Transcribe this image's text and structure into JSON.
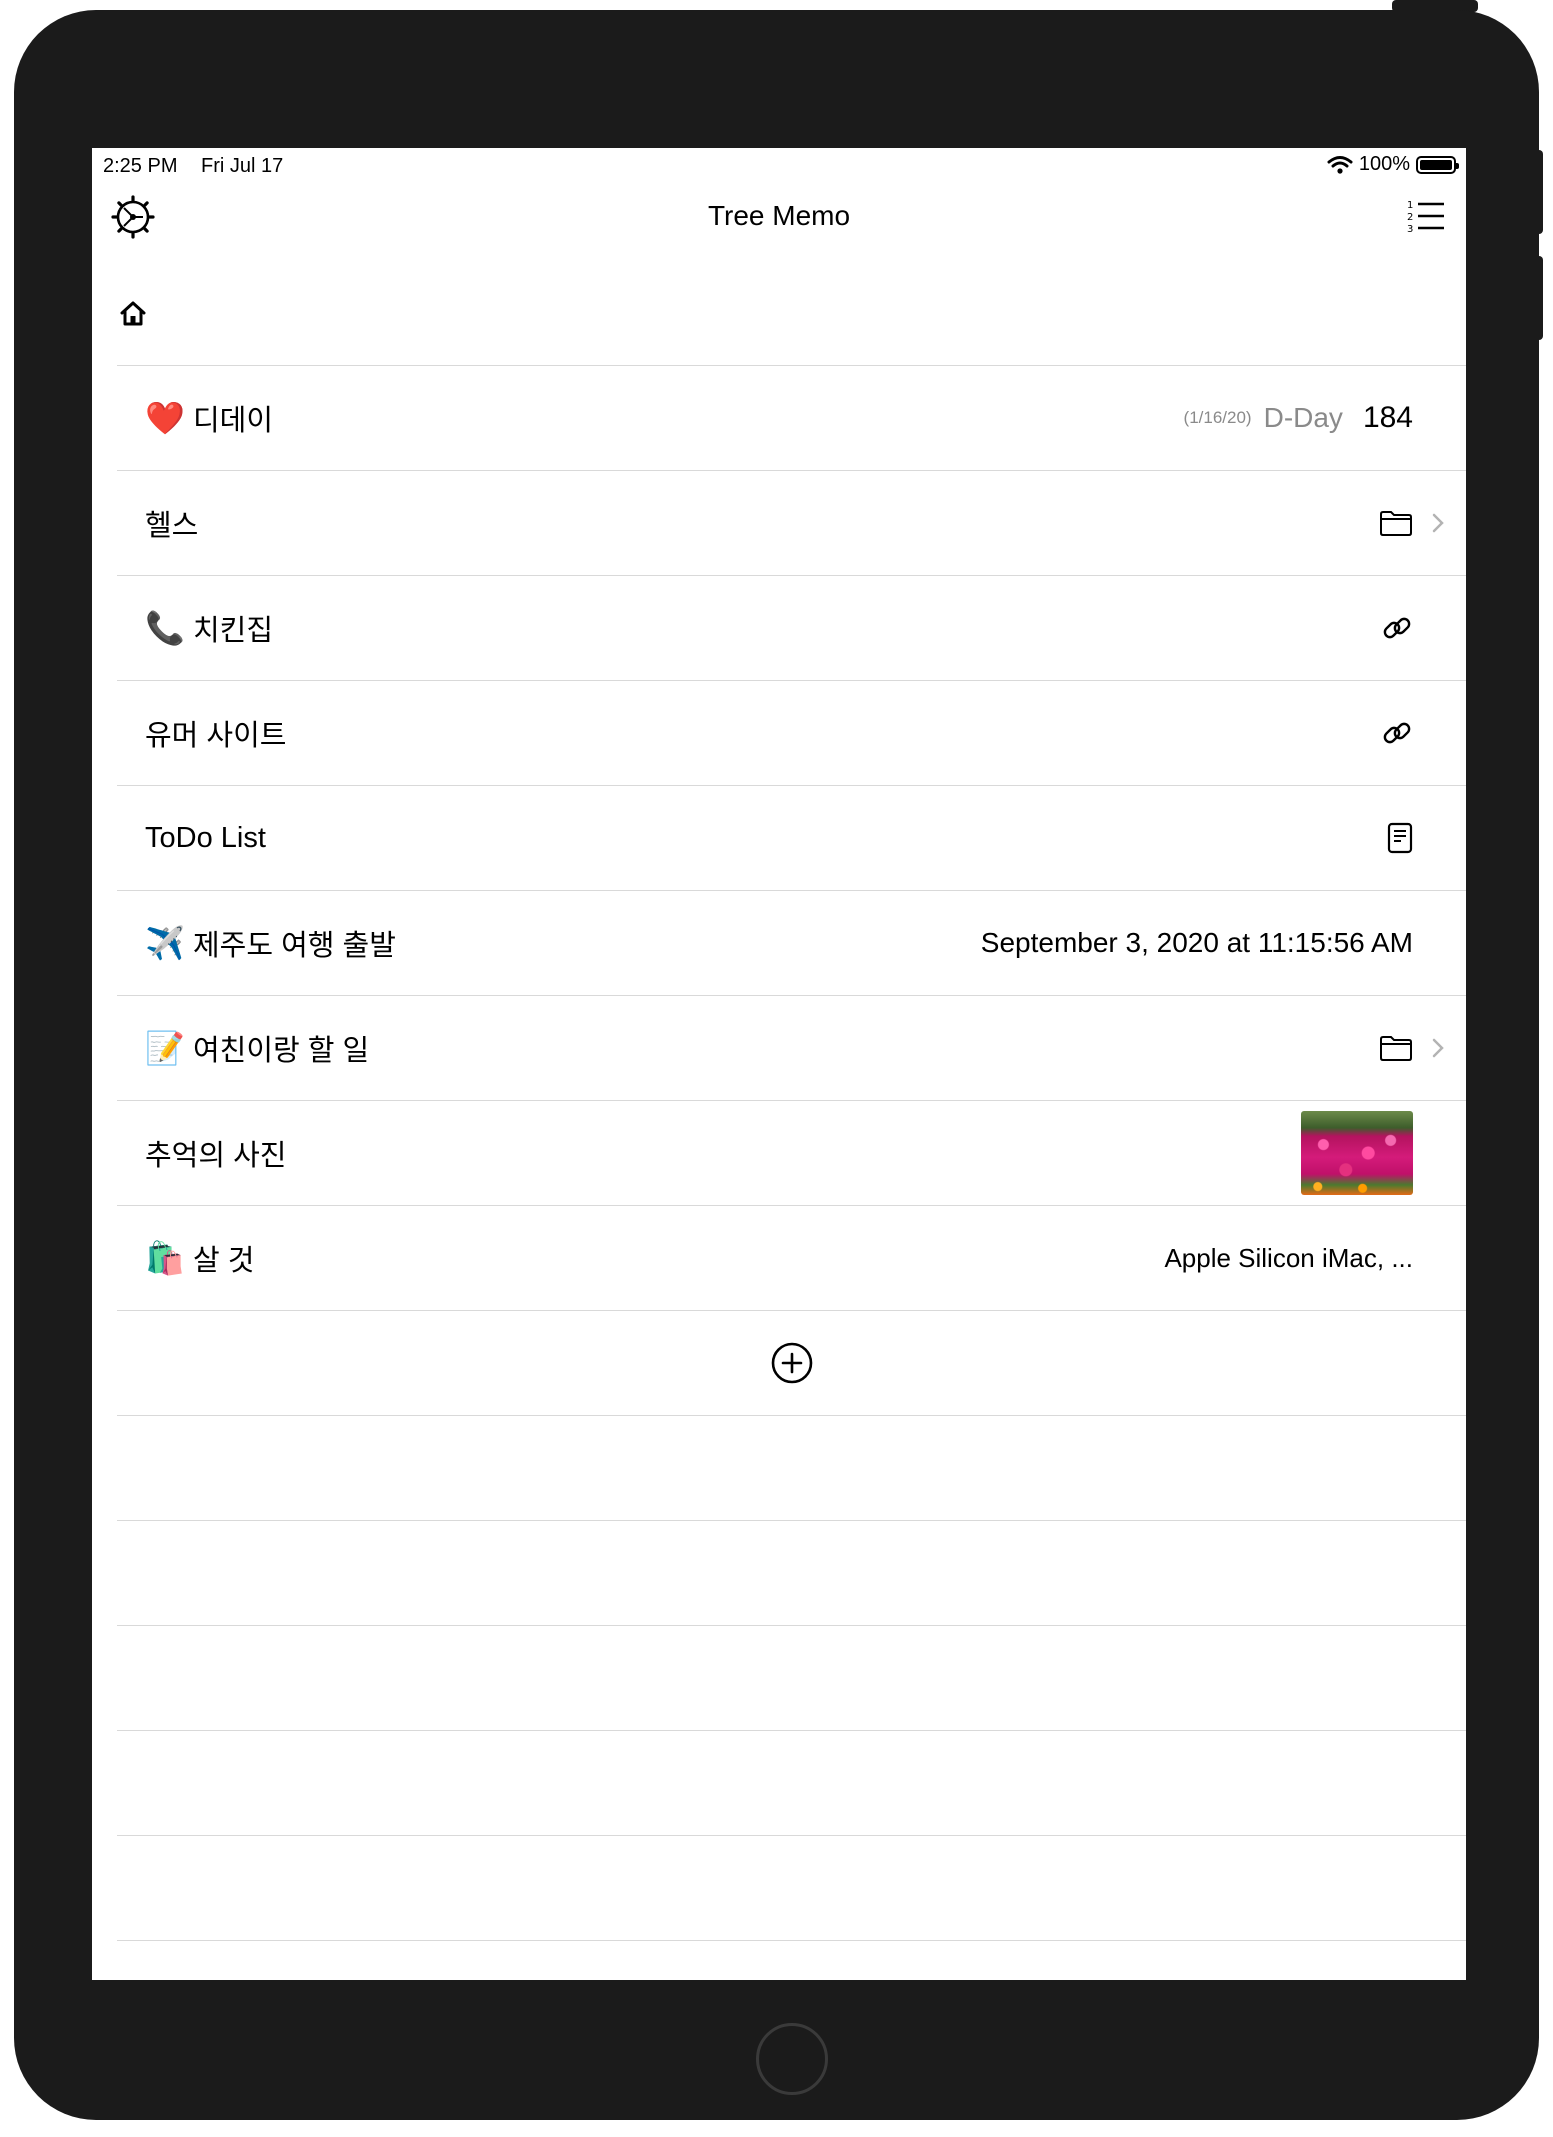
{
  "status_bar": {
    "time": "2:25 PM",
    "date": "Fri Jul 17",
    "battery": "100%",
    "battery_level": 1.0
  },
  "navbar": {
    "title": "Tree Memo",
    "left_icon": "settings-gear-icon",
    "right_icon": "numbered-list-icon"
  },
  "breadcrumb": {
    "icon": "home-icon"
  },
  "items": [
    {
      "emoji": "❤️",
      "label": "디데이",
      "type": "dday",
      "date": "(1/16/20)",
      "dday_label": "D-Day",
      "dday_count": "184"
    },
    {
      "emoji": "",
      "label": "헬스",
      "type": "folder",
      "icon": "folder-icon"
    },
    {
      "emoji": "📞",
      "label": "치킨집",
      "type": "link",
      "icon": "link-icon"
    },
    {
      "emoji": "",
      "label": "유머 사이트",
      "type": "link",
      "icon": "link-icon"
    },
    {
      "emoji": "",
      "label": "ToDo List",
      "type": "note",
      "icon": "document-icon"
    },
    {
      "emoji": "✈️",
      "label": "제주도 여행 출발",
      "type": "date",
      "value": "September 3, 2020 at 11:15:56 AM"
    },
    {
      "emoji": "📝",
      "label": "여친이랑 할 일",
      "type": "folder",
      "icon": "folder-icon"
    },
    {
      "emoji": "",
      "label": "추억의 사진",
      "type": "photo",
      "icon": "photo-thumbnail"
    },
    {
      "emoji": "🛍️",
      "label": "살 것",
      "type": "text",
      "value": "Apple Silicon iMac, ..."
    }
  ],
  "add_button": {
    "icon": "plus-circle-icon"
  },
  "colors": {
    "device": "#1b1b1b",
    "separator": "#d9d9d9",
    "secondary_text": "#8a8a8a"
  }
}
